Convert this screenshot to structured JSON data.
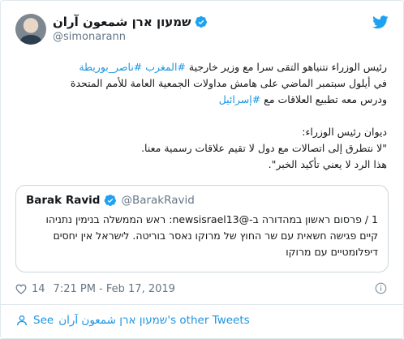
{
  "colors": {
    "link": "#1b95e0",
    "text": "#14171a",
    "muted": "#657786",
    "border": "#e1e8ed"
  },
  "author": {
    "name": "שמעון ארן شمعون آران",
    "handle": "@simonarann",
    "verified_icon": "verified-badge-icon",
    "logo_icon": "twitter-bird-icon"
  },
  "tweet": {
    "line1_text": "رئيس الوزراء نتنياهو التقى سرا مع وزير خارجية ",
    "line1_link1": "#المغرب",
    "line1_space": " ",
    "line1_link2": "#ناصر_بوريطة",
    "line2_text": "في أيلول سبتمبر الماضي على هامش مداولات الجمعية العامة للأمم المتحدة",
    "line3_text": "ودرس معه تطبيع العلاقات مع ",
    "line3_link": "#إسرائيل",
    "line4_text": "ديوان رئيس الوزراء:",
    "line5_text": "\"لا نتطرق إلى اتصالات مع دول لا تقيم علاقات رسمية معنا.",
    "line6_text": "هذا الرد لا يعني تأكيد الخبر\"."
  },
  "quoted": {
    "name": "Barak Ravid",
    "handle": "@BarakRavid",
    "line1": "1 / פרסום ראשון במהדורה ב-@newsisrael13: ראש הממשלה בנימין נתניהו",
    "line2": "קיים פגישה חשאית עם שר החוץ של מרוקו נאסר בוריטה. לישראל אין יחסים",
    "line3": "דיפלומטיים עם מרוקו"
  },
  "meta": {
    "likes": "14",
    "timestamp": "7:21 PM - Feb 17, 2019",
    "heart_icon": "heart-icon",
    "info_icon": "info-icon"
  },
  "footer": {
    "see_label": "See",
    "name": "שמעון ארן شمعون آران",
    "suffix": "'s other Tweets",
    "person_icon": "person-icon"
  }
}
